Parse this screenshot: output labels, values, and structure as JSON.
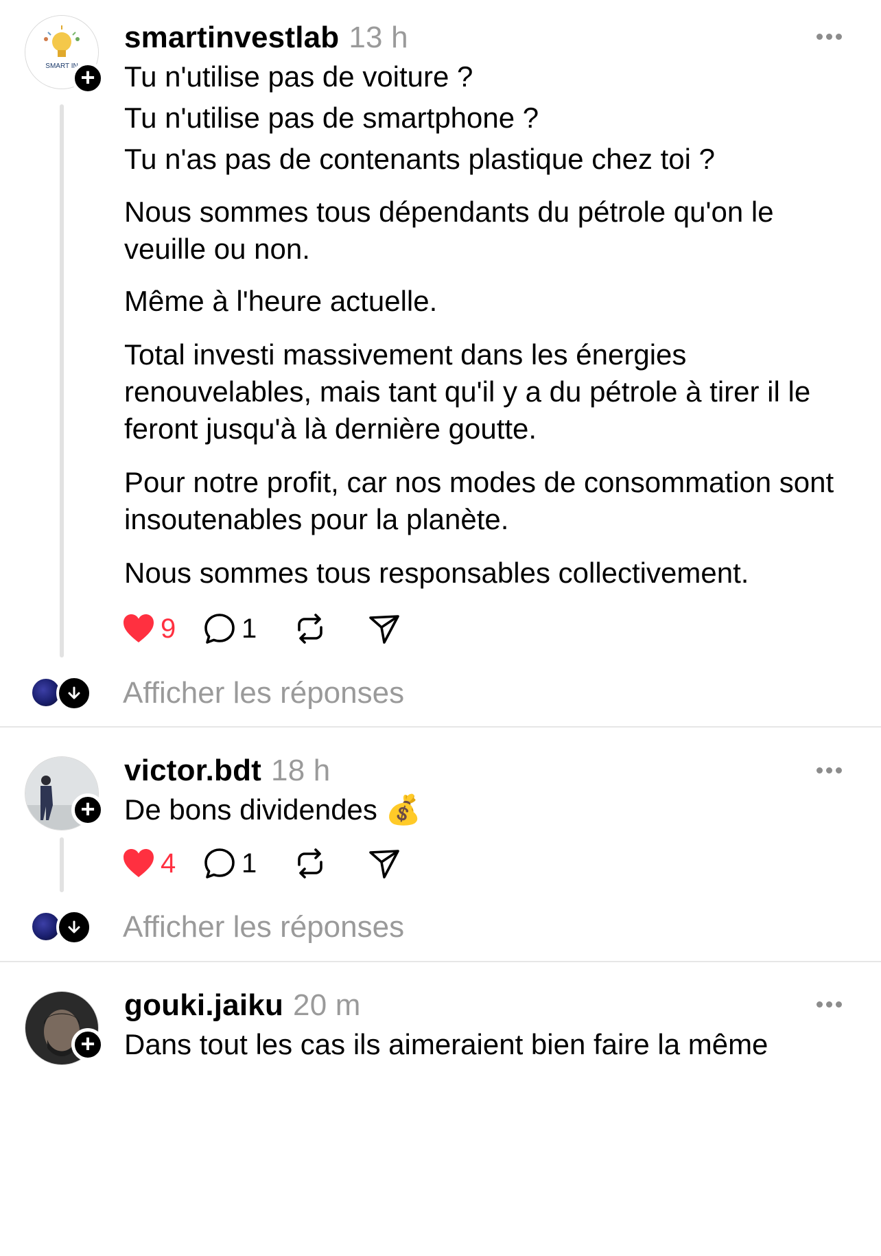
{
  "posts": [
    {
      "username": "smartinvestlab",
      "time": "13 h",
      "avatar_label": "SMART IN",
      "paragraphs": [
        "Tu n'utilise pas de voiture ?",
        "Tu n'utilise pas de smartphone ?",
        "Tu n'as pas de contenants plastique chez toi ?",
        "Nous sommes tous dépendants du pétrole qu'on le veuille ou non.",
        "Même à l'heure actuelle.",
        "Total investi massivement dans les énergies renouvelables, mais tant qu'il y a du pétrole à tirer il le feront jusqu'à là dernière goutte.",
        "Pour notre profit, car nos modes de consommation sont insoutenables pour la planète.",
        "Nous sommes tous responsables collectivement."
      ],
      "likes": "9",
      "comments": "1",
      "replies_label": "Afficher les réponses"
    },
    {
      "username": "victor.bdt",
      "time": "18 h",
      "text": "De bons dividendes 💰",
      "likes": "4",
      "comments": "1",
      "replies_label": "Afficher les réponses"
    },
    {
      "username": "gouki.jaiku",
      "time": "20 m",
      "text": "Dans tout les cas ils aimeraient bien faire la même"
    }
  ],
  "icons": {
    "like": "heart-icon",
    "comment": "comment-icon",
    "repost": "repost-icon",
    "share": "share-icon",
    "more": "more-icon",
    "follow": "plus-icon",
    "expand": "arrow-down-icon"
  },
  "colors": {
    "like": "#ff3040",
    "muted": "#9a9a9a",
    "thread_line": "#e2e2e2"
  }
}
